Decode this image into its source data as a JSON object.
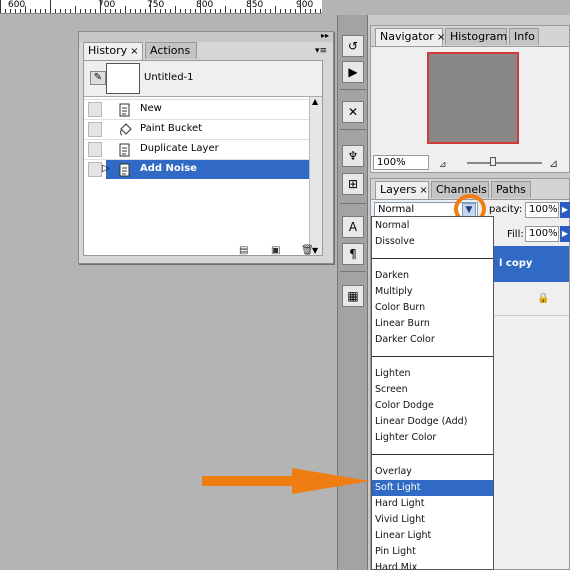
{
  "ruler": {
    "labels": [
      "600",
      "700",
      "750",
      "800",
      "850",
      "900"
    ]
  },
  "history_panel": {
    "tabs": [
      {
        "label": "History",
        "close": "×"
      },
      {
        "label": "Actions"
      }
    ],
    "collapse_glyph": "▸▸",
    "menu_glyph": "▾≡",
    "snapshot": {
      "label": "Untitled-1"
    },
    "items": [
      {
        "label": "New",
        "icon": "document-icon"
      },
      {
        "label": "Paint Bucket",
        "icon": "paint-bucket-icon"
      },
      {
        "label": "Duplicate Layer",
        "icon": "document-icon"
      },
      {
        "label": "Add Noise",
        "icon": "document-icon",
        "selected": true
      }
    ],
    "footer_icons": [
      "new-document-from-state-icon",
      "camera-snapshot-icon",
      "trash-icon"
    ]
  },
  "dock": {
    "buttons": [
      "history-brush-icon",
      "actions-play-icon",
      "tools-icon",
      "brush-presets-icon",
      "clone-source-icon",
      "character-icon",
      "paragraph-icon",
      "layer-comps-icon"
    ],
    "glyphs": {
      "character": "A",
      "paragraph": "¶"
    }
  },
  "navigator_pane": {
    "tabs": [
      {
        "label": "Navigator",
        "close": "×"
      },
      {
        "label": "Histogram"
      },
      {
        "label": "Info"
      }
    ],
    "zoom_value": "100%",
    "zoom_slider_fraction": 0.35
  },
  "layers_pane": {
    "tabs": [
      {
        "label": "Layers",
        "close": "×"
      },
      {
        "label": "Channels"
      },
      {
        "label": "Paths"
      }
    ],
    "blend_mode": "Normal",
    "opacity_label": "pacity:",
    "opacity_value": "100%",
    "fill_label": "Fill:",
    "fill_value": "100%",
    "layer_label": "l copy"
  },
  "blend_menu": {
    "groups": [
      [
        "Normal",
        "Dissolve"
      ],
      [
        "Darken",
        "Multiply",
        "Color Burn",
        "Linear Burn",
        "Darker Color"
      ],
      [
        "Lighten",
        "Screen",
        "Color Dodge",
        "Linear Dodge (Add)",
        "Lighter Color"
      ],
      [
        "Overlay",
        "Soft Light",
        "Hard Light",
        "Vivid Light",
        "Linear Light",
        "Pin Light",
        "Hard Mix"
      ]
    ],
    "selected": "Soft Light"
  },
  "colors": {
    "selection": "#316ac5",
    "annotation": "#f07d12",
    "navigator_frame": "#d23b3b"
  }
}
